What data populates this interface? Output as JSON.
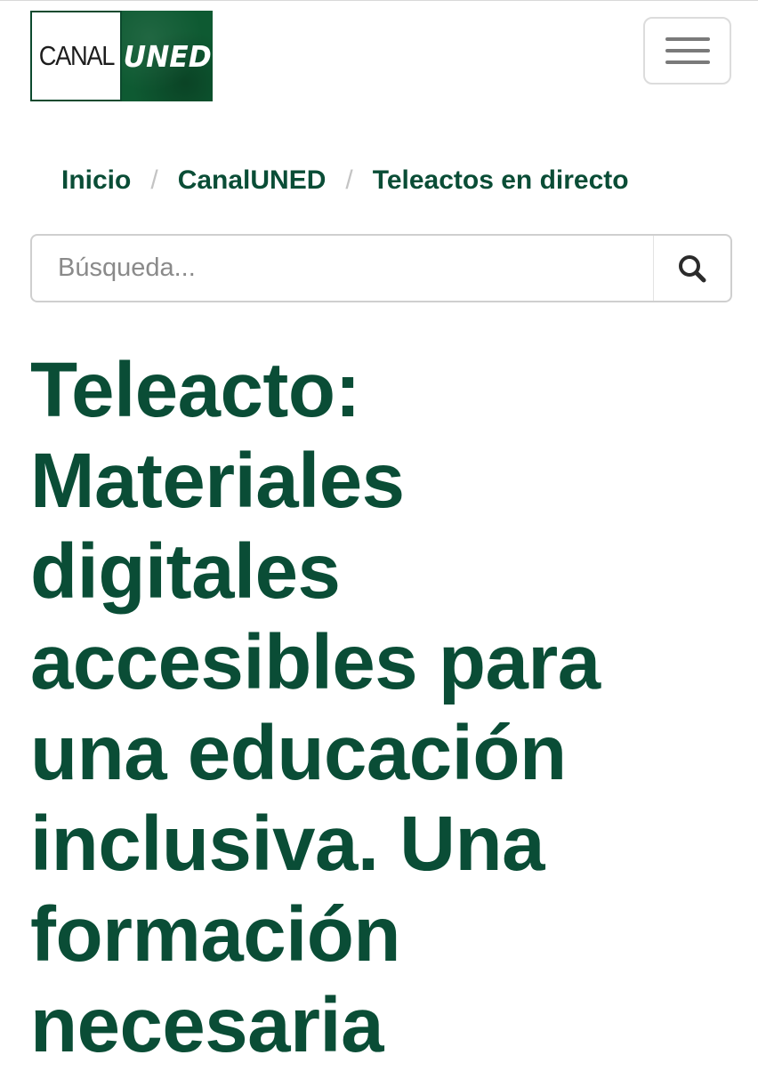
{
  "logo": {
    "left_text": "CANAL",
    "right_text": "UNED",
    "brand_color": "#0e5a32"
  },
  "header": {
    "menu_icon": "hamburger-icon"
  },
  "breadcrumb": {
    "items": [
      {
        "label": "Inicio"
      },
      {
        "label": "CanalUNED"
      },
      {
        "label": "Teleactos en directo"
      }
    ],
    "separator": "/"
  },
  "search": {
    "placeholder": "Búsqueda...",
    "value": "",
    "icon": "search-icon"
  },
  "page": {
    "title": "Teleacto: Materiales digitales accesibles para una educación inclusiva. Una formación necesaria",
    "accent_color": "#0a4d36"
  }
}
